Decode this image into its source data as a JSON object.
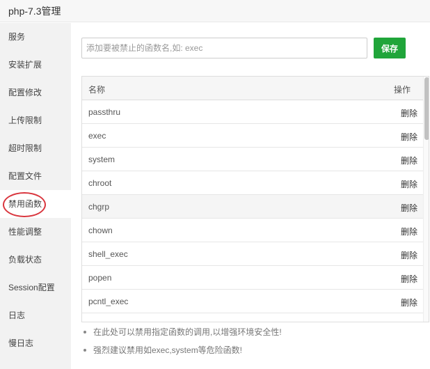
{
  "window": {
    "title": "php-7.3管理"
  },
  "sidebar": {
    "items": [
      {
        "label": "服务"
      },
      {
        "label": "安装扩展"
      },
      {
        "label": "配置修改"
      },
      {
        "label": "上传限制"
      },
      {
        "label": "超时限制"
      },
      {
        "label": "配置文件"
      },
      {
        "label": "禁用函数",
        "active": true
      },
      {
        "label": "性能调整"
      },
      {
        "label": "负载状态"
      },
      {
        "label": "Session配置"
      },
      {
        "label": "日志"
      },
      {
        "label": "慢日志"
      }
    ]
  },
  "form": {
    "placeholder": "添加要被禁止的函数名,如: exec",
    "value": "",
    "save_label": "保存"
  },
  "table": {
    "header": {
      "name": "名称",
      "operation": "操作"
    },
    "rows": [
      {
        "name": "passthru",
        "action": "删除"
      },
      {
        "name": "exec",
        "action": "删除"
      },
      {
        "name": "system",
        "action": "删除"
      },
      {
        "name": "chroot",
        "action": "删除"
      },
      {
        "name": "chgrp",
        "action": "删除"
      },
      {
        "name": "chown",
        "action": "删除"
      },
      {
        "name": "shell_exec",
        "action": "删除"
      },
      {
        "name": "popen",
        "action": "删除"
      },
      {
        "name": "pcntl_exec",
        "action": "删除"
      }
    ]
  },
  "tips": [
    "在此处可以禁用指定函数的调用,以增强环境安全性!",
    "强烈建议禁用如exec,system等危险函数!"
  ],
  "colors": {
    "accent": "#20a53a",
    "annotation": "#d9363e"
  }
}
